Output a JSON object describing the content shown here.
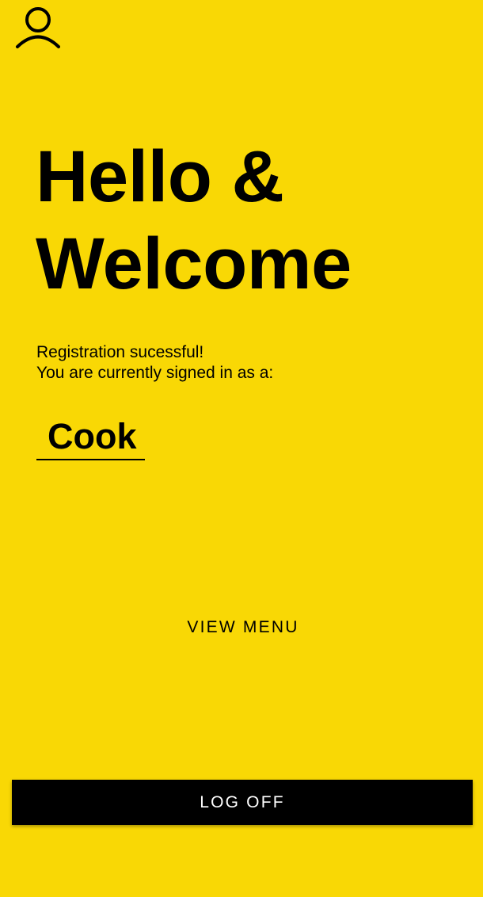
{
  "header": {
    "profile_icon": "person-outline-icon"
  },
  "greeting": {
    "line1": "Hello &",
    "line2": "Welcome"
  },
  "status": {
    "line1": "Registration sucessful!",
    "line2": "You are currently signed in as a:"
  },
  "role": {
    "value": "Cook"
  },
  "actions": {
    "view_menu_label": "VIEW MENU",
    "log_off_label": "LOG OFF"
  },
  "colors": {
    "background": "#F9D805",
    "button_background": "#000000",
    "button_text": "#FFFFFF",
    "text": "#000000"
  }
}
